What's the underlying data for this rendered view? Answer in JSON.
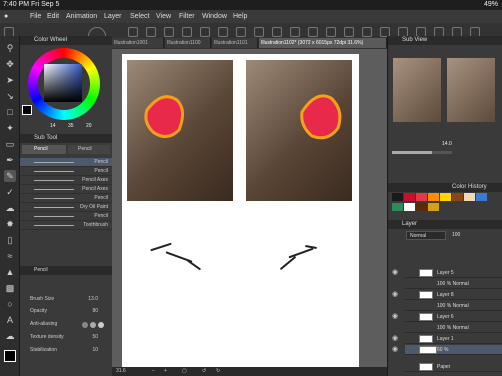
{
  "status": {
    "time": "7:40 PM  Fri Sep 5",
    "battery": "49%"
  },
  "menu": [
    "File",
    "Edit",
    "Animation",
    "Layer",
    "Select",
    "View",
    "Filter",
    "Window",
    "Help"
  ],
  "doc_tabs": [
    {
      "label": "Illustration1001",
      "active": false
    },
    {
      "label": "Illustration1100",
      "active": false
    },
    {
      "label": "Illustration1101",
      "active": false
    },
    {
      "label": "Illustration1102* (3072 x 6015px 72dpi 31.6%)",
      "active": true
    }
  ],
  "left": {
    "color_wheel_title": "Color Wheel",
    "color_values": [
      "14",
      "35",
      "20"
    ],
    "sub_tool_title": "Sub Tool",
    "sub_tool_tab": "Pencil",
    "sub_tool_tab2": "Pencil",
    "brushes": [
      {
        "name": "Pencil",
        "size": ""
      },
      {
        "name": "Pencil",
        "size": ""
      },
      {
        "name": "Pencil Axes",
        "size": ""
      },
      {
        "name": "Pencil Axes",
        "size": ""
      },
      {
        "name": "Pencil",
        "size": ""
      },
      {
        "name": "Dry Oil Paint",
        "size": ""
      },
      {
        "name": "Pencil",
        "size": ""
      },
      {
        "name": "Toothbrush",
        "size": ""
      }
    ],
    "active_brush": "Pencil",
    "props": [
      {
        "label": "Brush Size",
        "value": "13.0"
      },
      {
        "label": "Opacity",
        "value": "80"
      },
      {
        "label": "Anti-aliasing",
        "value": ""
      },
      {
        "label": "Texture density",
        "value": "50"
      },
      {
        "label": "Stabilization",
        "value": "10"
      }
    ]
  },
  "bottom": {
    "zoom": "31.6"
  },
  "right": {
    "sub_view_title": "Sub View",
    "zoom_value": "14.0",
    "color_history_title": "Color History",
    "swatches": [
      "#1a1a1a",
      "#c8102e",
      "#e63946",
      "#ff8c00",
      "#ffd700",
      "#8b4513",
      "#f0d9b5",
      "#3a7bd5",
      "#2e8b57",
      "#ffffff",
      "#5a2a0a",
      "#d4a017"
    ],
    "layer_title": "Layer",
    "blend_mode": "Normal",
    "opacity": "100",
    "layers": [
      {
        "name": "Layer 5"
      },
      {
        "name": "100 % Normal"
      },
      {
        "name": "Layer 8"
      },
      {
        "name": "100 % Normal"
      },
      {
        "name": "Layer 6"
      },
      {
        "name": "100 % Normal"
      },
      {
        "name": "Layer 1"
      },
      {
        "name": "60 %"
      },
      {
        "name": "Paper"
      }
    ]
  }
}
